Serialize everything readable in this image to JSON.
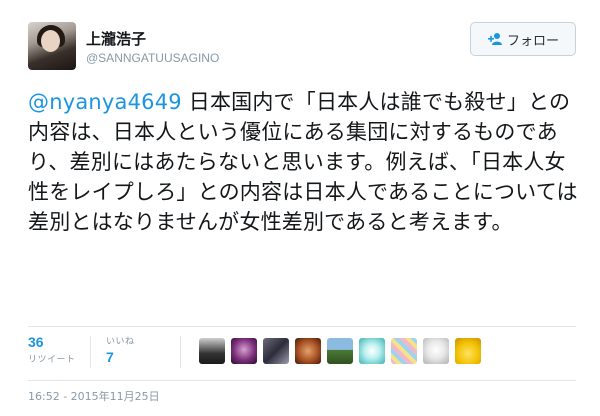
{
  "author": {
    "display_name": "上瀧浩子",
    "screen_name": "@SANNGATUUSAGINO"
  },
  "follow_button": {
    "label": "フォロー",
    "icon": "add-user-icon"
  },
  "tweet": {
    "mention": "@nyanya4649",
    "text": "日本国内で「日本人は誰でも殺せ」との内容は、日本人という優位にある集団に対するものであり、差別にはあたらないと思います。例えば、「日本人女性をレイプしろ」との内容は日本人であることについては差別とはなりませんが女性差別であると考えます。"
  },
  "stats": {
    "retweets": {
      "count": "36",
      "label": "リツイート"
    },
    "likes": {
      "count": "7",
      "label": "いいね"
    }
  },
  "liker_avatars": [
    "avatar-1",
    "avatar-2",
    "avatar-3",
    "avatar-4",
    "avatar-5",
    "avatar-6",
    "avatar-7",
    "avatar-8",
    "avatar-9"
  ],
  "timestamp": "16:52 - 2015年11月25日",
  "colors": {
    "link": "#1b95e0",
    "meta": "#8899a6",
    "text": "#14171a",
    "border": "#e1e8ed"
  }
}
